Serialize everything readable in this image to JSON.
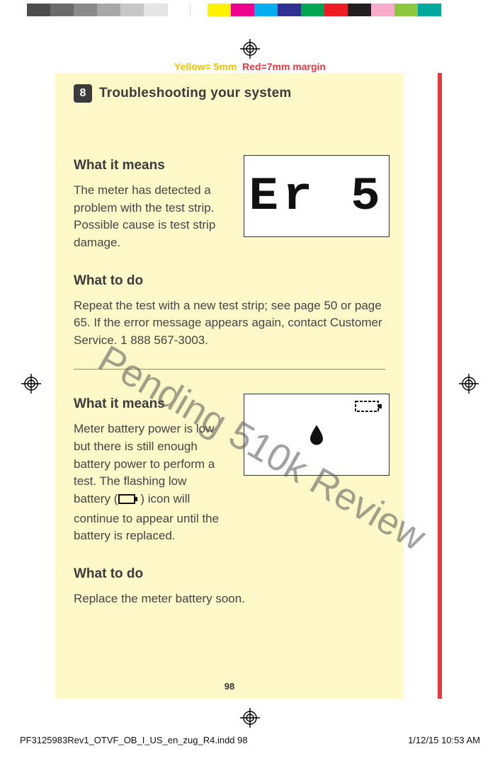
{
  "colorbar_greys": [
    "#4d4d4d",
    "#6b6b6b",
    "#8a8a8a",
    "#a8a8a8",
    "#c7c7c7",
    "#e6e6e6",
    "#ffffff"
  ],
  "colorbar_colors": [
    "#fff200",
    "#ec008c",
    "#00aeef",
    "#2e3192",
    "#00a651",
    "#ed1c24",
    "#231f20",
    "#f7adc9",
    "#8dc63f",
    "#00a99d"
  ],
  "margin_note_yellow": "Yellow= 5mm",
  "margin_note_red": "Red=7mm margin",
  "section_number": "8",
  "section_title": "Troubleshooting your system",
  "entry1": {
    "h_means": "What it means",
    "means_text": "The meter has detected a problem with the test strip. Possible cause is test strip damage.",
    "lcd_code": "Er 5",
    "h_do": "What to do",
    "do_text": "Repeat the test with a new test strip; see page 50 or page 65. If the error message appears again, contact Customer Service. 1 888 567-3003."
  },
  "entry2": {
    "h_means": "What it means",
    "means_text_pre": "Meter battery power is low but there is still enough battery power to perform a test. The flashing low battery (",
    "means_text_post": ") icon will continue to appear until the battery is replaced.",
    "h_do": "What to do",
    "do_text": "Replace the meter battery soon."
  },
  "watermark": "Pending 510k Review",
  "page_number": "98",
  "slug_file": "PF3125983Rev1_OTVF_OB_I_US_en_zug_R4.indd   98",
  "slug_time": "1/12/15   10:53 AM"
}
